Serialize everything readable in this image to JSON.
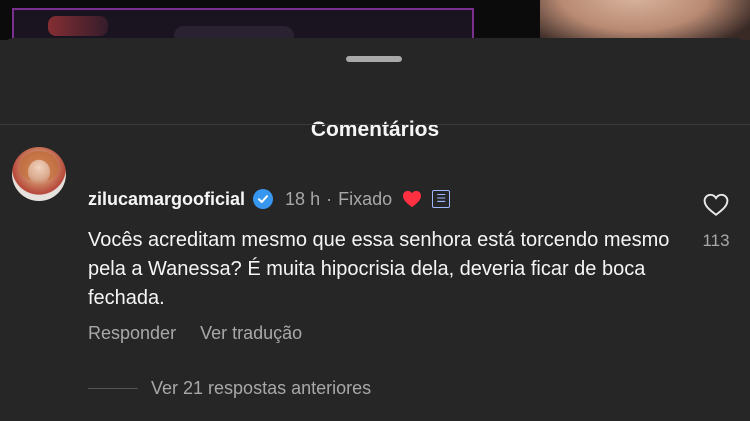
{
  "sheet": {
    "title": "Comentários"
  },
  "comment": {
    "username": "zilucamargooficial",
    "time": "18 h",
    "separator": "·",
    "pinned_label": "Fixado",
    "text": "Vocês acreditam mesmo que essa senhora está torcendo mesmo pela a Wanessa? É muita hipocrisia dela, deveria ficar de boca fechada.",
    "reply_label": "Responder",
    "translate_label": "Ver tradução",
    "like_count": "113",
    "view_replies_label": "Ver 21 respostas anteriores"
  },
  "colors": {
    "background": "#262626",
    "verified": "#3797f0",
    "heart": "#ff3040",
    "muted_text": "#a8a8a8"
  },
  "icons": [
    "verified-badge-icon",
    "heart-filled-icon",
    "creator-badge-icon",
    "heart-outline-icon"
  ]
}
